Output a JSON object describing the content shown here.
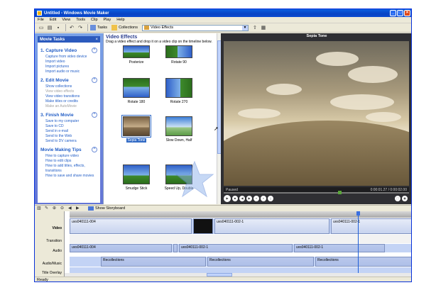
{
  "window": {
    "title": "Untitled - Windows Movie Maker"
  },
  "menu": [
    "File",
    "Edit",
    "View",
    "Tools",
    "Clip",
    "Play",
    "Help"
  ],
  "toolbar": {
    "tasks_label": "Tasks",
    "collections_label": "Collections",
    "combo_value": "Video Effects"
  },
  "tasks": {
    "header": "Movie Tasks",
    "sections": [
      {
        "title": "1. Capture Video",
        "items": [
          {
            "label": "Capture from video device",
            "enabled": true
          },
          {
            "label": "Import video",
            "enabled": true
          },
          {
            "label": "Import pictures",
            "enabled": true
          },
          {
            "label": "Import audio or music",
            "enabled": true
          }
        ]
      },
      {
        "title": "2. Edit Movie",
        "items": [
          {
            "label": "Show collections",
            "enabled": true
          },
          {
            "label": "View video effects",
            "enabled": false
          },
          {
            "label": "View video transitions",
            "enabled": true
          },
          {
            "label": "Make titles or credits",
            "enabled": true
          },
          {
            "label": "Make an AutoMovie",
            "enabled": false
          }
        ]
      },
      {
        "title": "3. Finish Movie",
        "items": [
          {
            "label": "Save to my computer",
            "enabled": true
          },
          {
            "label": "Save to CD",
            "enabled": true
          },
          {
            "label": "Send in e-mail",
            "enabled": true
          },
          {
            "label": "Send to the Web",
            "enabled": true
          },
          {
            "label": "Send to DV camera",
            "enabled": true
          }
        ]
      },
      {
        "title": "Movie Making Tips",
        "items": [
          {
            "label": "How to capture video",
            "enabled": true
          },
          {
            "label": "How to edit clips",
            "enabled": true
          },
          {
            "label": "How to add titles, effects, transitions",
            "enabled": true
          },
          {
            "label": "How to save and share movies",
            "enabled": true
          }
        ]
      }
    ]
  },
  "effects": {
    "title": "Video Effects",
    "subtitle": "Drag a video effect and drop it on a video clip on the timeline below.",
    "items": [
      {
        "label": "Posterize",
        "selected": false
      },
      {
        "label": "Rotate 90",
        "selected": false
      },
      {
        "label": "Rotate 180",
        "selected": false
      },
      {
        "label": "Rotate 270",
        "selected": false
      },
      {
        "label": "Sepia Tone",
        "selected": true
      },
      {
        "label": "Slow Down, Half",
        "selected": false
      },
      {
        "label": "Smudge Stick",
        "selected": false
      },
      {
        "label": "Speed Up, Double",
        "selected": false
      }
    ]
  },
  "preview": {
    "title": "Sepia Tone",
    "status": "Paused",
    "time": "0:00:01.27 / 0:00:02.00"
  },
  "timeline": {
    "show_storyboard": "Show Storyboard",
    "labels": {
      "video": "Video",
      "transition": "Transition",
      "audio": "Audio",
      "audio_music": "Audio/Music",
      "title_overlay": "Title Overlay"
    },
    "video_clips": [
      "uvs040111-004",
      "uvs040111-002-1",
      "uvs040111-002-1"
    ],
    "audio_clips": [
      "uvs040111-004",
      "uvs040111-002-1",
      "uvs040111-002-1"
    ],
    "music_clips": [
      "Recollections",
      "Recollections",
      "Recollections"
    ]
  },
  "statusbar": {
    "text": "Ready"
  }
}
